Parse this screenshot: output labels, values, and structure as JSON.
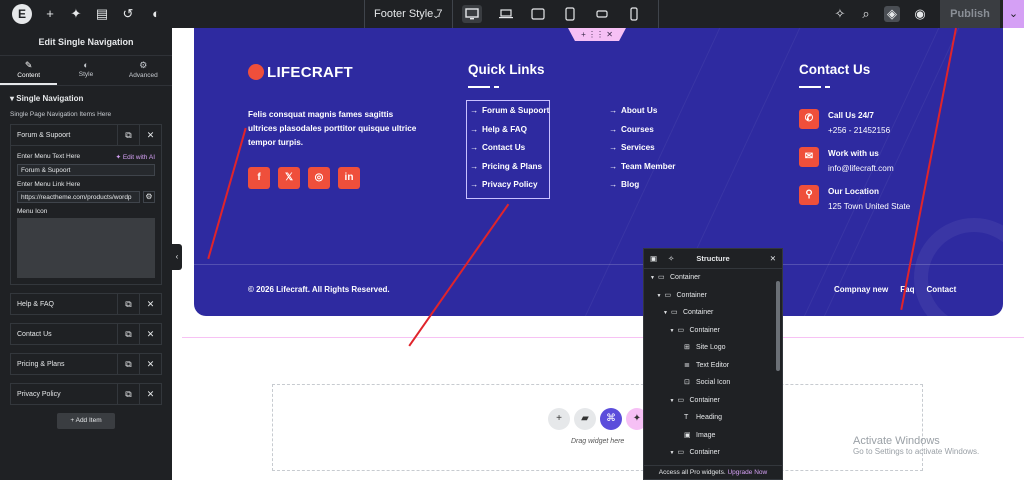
{
  "topbar": {
    "logo": "E",
    "template_title": "Footer Style 7",
    "publish": "Publish"
  },
  "panel": {
    "title": "Edit Single Navigation",
    "tabs": [
      {
        "label": "Content"
      },
      {
        "label": "Style"
      },
      {
        "label": "Advanced"
      }
    ],
    "section": "Single Navigation",
    "subtitle": "Single Page Navigation Items Here",
    "expanded": {
      "label": "Forum & Supoort",
      "menu_text_label": "Enter Menu Text Here",
      "edit_ai": "Edit with AI",
      "menu_text_value": "Forum & Supoort",
      "menu_link_label": "Enter Menu Link Here",
      "menu_link_value": "https://reactheme.com/products/wordp",
      "menu_icon_label": "Menu Icon"
    },
    "items": [
      {
        "label": "Help & FAQ"
      },
      {
        "label": "Contact Us"
      },
      {
        "label": "Pricing & Plans"
      },
      {
        "label": "Privacy Policy"
      }
    ],
    "add_item": "Add Item"
  },
  "footer": {
    "logo": "LIFECRAFT",
    "description": "Felis consquat magnis fames sagittis ultrices plasodales porttitor quisque ultrice tempor turpis.",
    "socials": [
      {
        "glyph": "f",
        "name": "facebook-icon"
      },
      {
        "glyph": "𝕏",
        "name": "x-icon"
      },
      {
        "glyph": "◎",
        "name": "instagram-icon"
      },
      {
        "glyph": "in",
        "name": "linkedin-icon"
      }
    ],
    "quick_title": "Quick Links",
    "quick_links": [
      {
        "label": "Forum & Supoort"
      },
      {
        "label": "Help & FAQ"
      },
      {
        "label": "Contact Us"
      },
      {
        "label": "Pricing & Plans"
      },
      {
        "label": "Privacy Policy"
      }
    ],
    "about_links": [
      {
        "label": "About Us"
      },
      {
        "label": "Courses"
      },
      {
        "label": "Services"
      },
      {
        "label": "Team Member"
      },
      {
        "label": "Blog"
      }
    ],
    "contact_title": "Contact Us",
    "contacts": [
      {
        "icon": "phone-icon",
        "glyph": "✆",
        "label": "Call Us 24/7",
        "value": "+256 - 21452156"
      },
      {
        "icon": "mail-icon",
        "glyph": "✉",
        "label": "Work with us",
        "value": "info@lifecraft.com"
      },
      {
        "icon": "location-icon",
        "glyph": "⚲",
        "label": "Our Location",
        "value": "125 Town United State"
      }
    ],
    "copyright": "© 2026 Lifecraft. All Rights Reserved.",
    "bottom_links": [
      {
        "label": "Compnay new"
      },
      {
        "label": "Faq"
      },
      {
        "label": "Contact"
      }
    ]
  },
  "dropzone": {
    "text": "Drag widget here"
  },
  "activate": {
    "line1": "Activate Windows",
    "line2": "Go to Settings to activate Windows."
  },
  "structure": {
    "title": "Structure",
    "rows": [
      {
        "label": "Container",
        "icon": "container-icon",
        "glyph": "▭",
        "toggle": "▼",
        "level": 0
      },
      {
        "label": "Container",
        "icon": "container-icon",
        "glyph": "▭",
        "toggle": "▼",
        "level": 1
      },
      {
        "label": "Container",
        "icon": "container-icon",
        "glyph": "▭",
        "toggle": "▼",
        "level": 2
      },
      {
        "label": "Container",
        "icon": "container-icon",
        "glyph": "▭",
        "toggle": "▼",
        "level": 3
      },
      {
        "label": "Site Logo",
        "icon": "site-logo-icon",
        "glyph": "⊞",
        "toggle": "",
        "level": 4
      },
      {
        "label": "Text Editor",
        "icon": "text-editor-icon",
        "glyph": "≣",
        "toggle": "",
        "level": 4
      },
      {
        "label": "Social Icon",
        "icon": "social-icon-icon",
        "glyph": "⊡",
        "toggle": "",
        "level": 4
      },
      {
        "label": "Container",
        "icon": "container-icon",
        "glyph": "▭",
        "toggle": "▼",
        "level": 3
      },
      {
        "label": "Heading",
        "icon": "heading-icon",
        "glyph": "T",
        "toggle": "",
        "level": 4
      },
      {
        "label": "Image",
        "icon": "image-icon",
        "glyph": "▣",
        "toggle": "",
        "level": 4
      },
      {
        "label": "Container",
        "icon": "container-icon",
        "glyph": "▭",
        "toggle": "▼",
        "level": 3
      }
    ],
    "footer_text": "Access all Pro widgets.",
    "footer_link": "Upgrade Now"
  },
  "colors": {
    "footer_bg": "#2e2aa0",
    "accent": "#ef4f3b",
    "editor_dark": "#1f2124",
    "pink": "#d5a0f5",
    "annotation": "#e0242b"
  }
}
